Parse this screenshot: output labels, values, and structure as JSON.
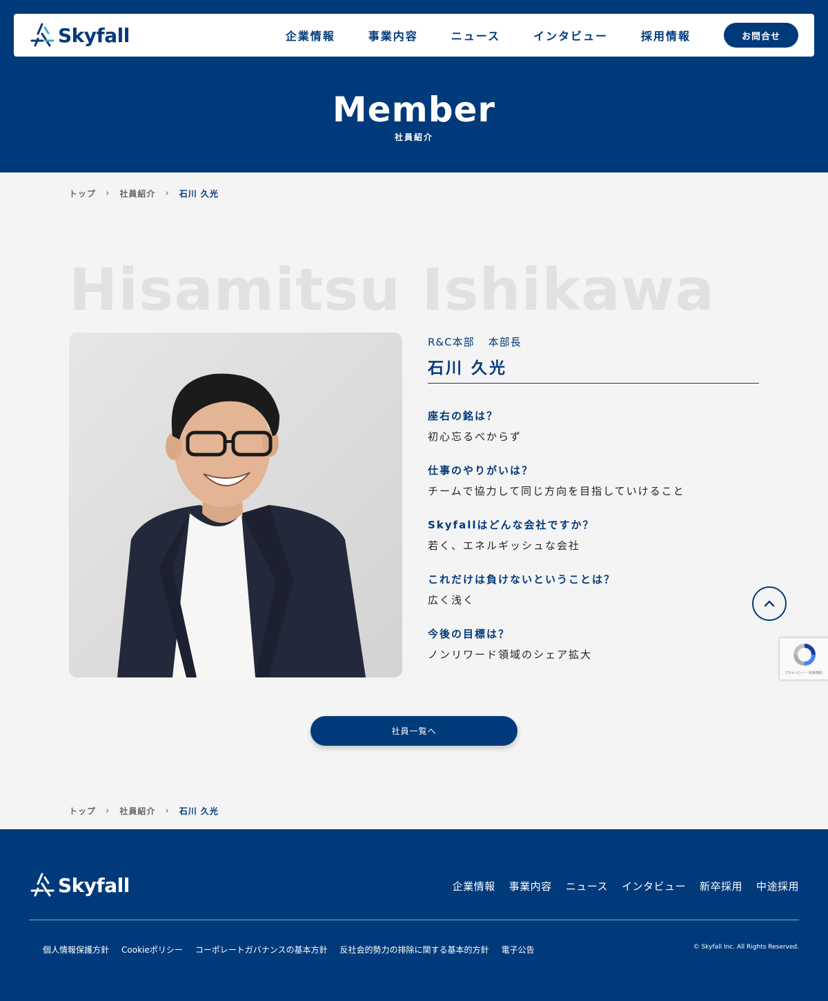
{
  "brand": {
    "name": "Skyfall"
  },
  "header": {
    "nav": [
      "企業情報",
      "事業内容",
      "ニュース",
      "インタビュー",
      "採用情報"
    ],
    "contact_label": "お問合せ"
  },
  "hero": {
    "title": "Member",
    "subtitle": "社員紹介"
  },
  "breadcrumbs": [
    "トップ",
    "社員紹介",
    "石川 久光"
  ],
  "profile": {
    "name_en": "Hisamitsu Ishikawa",
    "department": "R&C本部",
    "role": "本部長",
    "name": "石川 久光",
    "qa": [
      {
        "q": "座右の銘は？",
        "a": "初心忘るべからず"
      },
      {
        "q": "仕事のやりがいは？",
        "a": "チームで協力して同じ方向を目指していけること"
      },
      {
        "q": "Skyfallはどんな会社ですか？",
        "a": "若く、エネルギッシュな会社"
      },
      {
        "q": "これだけは負けないということは？",
        "a": "広く浅く"
      },
      {
        "q": "今後の目標は？",
        "a": "ノンリワード領域のシェア拡大"
      }
    ]
  },
  "list_button": "社員一覧へ",
  "recaptcha_text": "プライバシー・利用規約",
  "footer": {
    "nav": [
      "企業情報",
      "事業内容",
      "ニュース",
      "インタビュー",
      "新卒採用",
      "中途採用"
    ],
    "links": [
      "個人情報保護方針",
      "Cookieポリシー",
      "コーポレートガバナンスの基本方針",
      "反社会的勢力の排除に関する基本的方針",
      "電子公告"
    ],
    "copyright": "© Skyfall Inc. All Rights Reserved."
  },
  "colors": {
    "primary": "#003a7b",
    "background": "#f4f4f4"
  }
}
